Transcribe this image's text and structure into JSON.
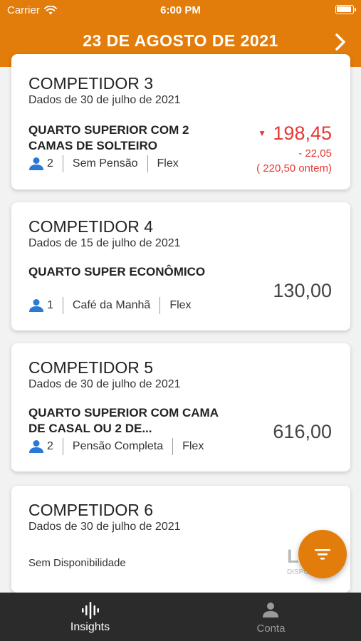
{
  "status_bar": {
    "carrier": "Carrier",
    "time": "6:00 PM"
  },
  "header": {
    "title": "23 DE AGOSTO DE 2021"
  },
  "competitors": [
    {
      "name": "COMPETIDOR 3",
      "date": "Dados de 30 de julho de 2021",
      "room": "QUARTO SUPERIOR COM 2 CAMAS DE SOLTEIRO",
      "guests": "2",
      "meal": "Sem Pensão",
      "rate": "Flex",
      "price": "198,45",
      "change": "- 22,05",
      "previous": "( 220,50 ontem)"
    },
    {
      "name": "COMPETIDOR 4",
      "date": "Dados de 15 de julho de 2021",
      "room": "QUARTO SUPER ECONÔMICO",
      "guests": "1",
      "meal": "Café da Manhã",
      "rate": "Flex",
      "price": "130,00"
    },
    {
      "name": "COMPETIDOR 5",
      "date": "Dados de 30 de julho de 2021",
      "room": "QUARTO SUPERIOR COM CAMA DE CASAL OU 2 DE...",
      "guests": "2",
      "meal": "Pensão Completa",
      "rate": "Flex",
      "price": "616,00"
    },
    {
      "name": "COMPETIDOR 6",
      "date": "Dados de 30 de julho de 2021",
      "status": "Sem Disponibilidade",
      "partial_text": "LO",
      "partial_sub": "DISPO"
    }
  ],
  "tabs": [
    {
      "label": "Insights",
      "icon": "insights-icon",
      "active": true
    },
    {
      "label": "Conta",
      "icon": "person-icon",
      "active": false
    }
  ],
  "colors": {
    "accent": "#e27c0a",
    "price_down": "#e53935",
    "guest_icon": "#2979d6",
    "tabbar": "#2b2b2b"
  }
}
